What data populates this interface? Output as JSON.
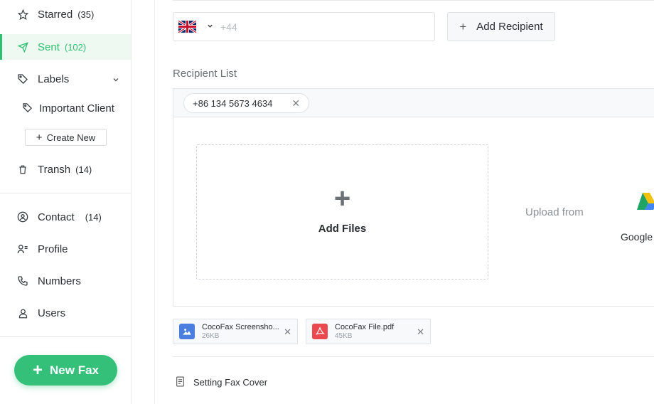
{
  "sidebar": {
    "items": [
      {
        "label": "Starred",
        "count": "(35)"
      },
      {
        "label": "Sent",
        "count": "(102)"
      },
      {
        "label": "Labels"
      },
      {
        "label": "Transh",
        "count": "(14)"
      },
      {
        "label": "Contact",
        "count": "(14)"
      },
      {
        "label": "Profile"
      },
      {
        "label": "Numbers"
      },
      {
        "label": "Users"
      }
    ],
    "sub_label": "Important Client",
    "create_new": "Create New",
    "new_fax": "New Fax"
  },
  "compose": {
    "phone_prefix": "+44",
    "add_recipient": "Add Recipient",
    "recipient_list_title": "Recipient List",
    "recipients": [
      "+86 134 5673 4634"
    ],
    "add_files": "Add Files",
    "upload_from": "Upload from",
    "upload_source": "Google",
    "files": [
      {
        "name": "CocoFax Screensho...",
        "size": "26KB",
        "type": "image"
      },
      {
        "name": "CocoFax File.pdf",
        "size": "45KB",
        "type": "pdf"
      }
    ],
    "fax_cover": "Setting Fax Cover"
  },
  "colors": {
    "accent": "#35c07a",
    "active_bg": "#eef9f2",
    "image_icon": "#4a7fe0",
    "pdf_icon": "#ea4a4f"
  }
}
